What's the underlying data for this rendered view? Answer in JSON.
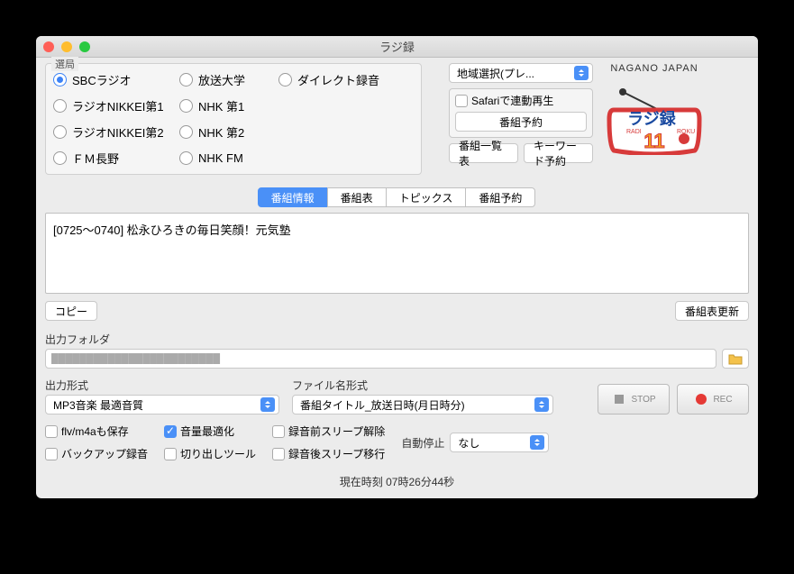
{
  "window": {
    "title": "ラジ録"
  },
  "stations": {
    "legend": "選局",
    "selected": "SBCラジオ",
    "items": [
      "SBCラジオ",
      "放送大学",
      "ダイレクト録音",
      "ラジオNIKKEI第1",
      "NHK 第1",
      "",
      "ラジオNIKKEI第2",
      "NHK 第2",
      "",
      "ＦＭ長野",
      "NHK FM",
      ""
    ]
  },
  "region_select": "地域選択(プレ...",
  "safari_check": "Safariで連動再生",
  "reserve_btn": "番組予約",
  "list_btn": "番組一覧表",
  "keyword_btn": "キーワード予約",
  "logo_caption": "NAGANO JAPAN",
  "tabs": [
    "番組情報",
    "番組表",
    "トピックス",
    "番組予約"
  ],
  "tabs_active": 0,
  "program_info": "[0725〜0740] 松永ひろきの毎日笑顔！元気塾",
  "copy_btn": "コピー",
  "update_btn": "番組表更新",
  "output_folder_label": "出力フォルダ",
  "output_folder_value": "████████████████████████",
  "output_format_label": "出力形式",
  "output_format_value": "MP3音楽 最適音質",
  "filename_format_label": "ファイル名形式",
  "filename_format_value": "番組タイトル_放送日時(月日時分)",
  "stop_btn": "STOP",
  "rec_btn": "REC",
  "checks": {
    "flv": "flv/m4aも保存",
    "backup": "バックアップ録音",
    "volume": "音量最適化",
    "cutout": "切り出しツール",
    "prewake": "録音前スリープ解除",
    "postsleep": "録音後スリープ移行"
  },
  "auto_stop_label": "自動停止",
  "auto_stop_value": "なし",
  "current_time": "現在時刻 07時26分44秒"
}
